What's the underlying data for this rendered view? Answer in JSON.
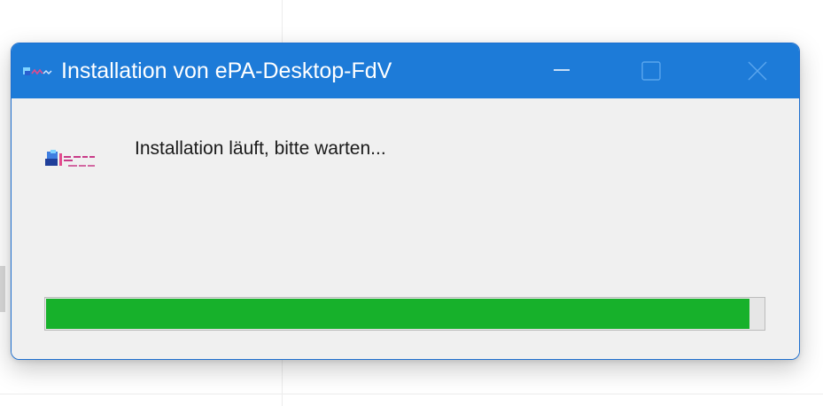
{
  "window": {
    "title": "Installation von ePA-Desktop-FdV",
    "accent_color": "#1d7bd8",
    "controls": {
      "minimize_icon": "minimize-icon",
      "maximize_icon": "maximize-icon",
      "close_icon": "close-icon"
    }
  },
  "content": {
    "status_text": "Installation läuft, bitte warten...",
    "logo_icon": "vendor-logo-icon"
  },
  "progress": {
    "fraction": 0.98,
    "fill_color": "#17b12b"
  }
}
